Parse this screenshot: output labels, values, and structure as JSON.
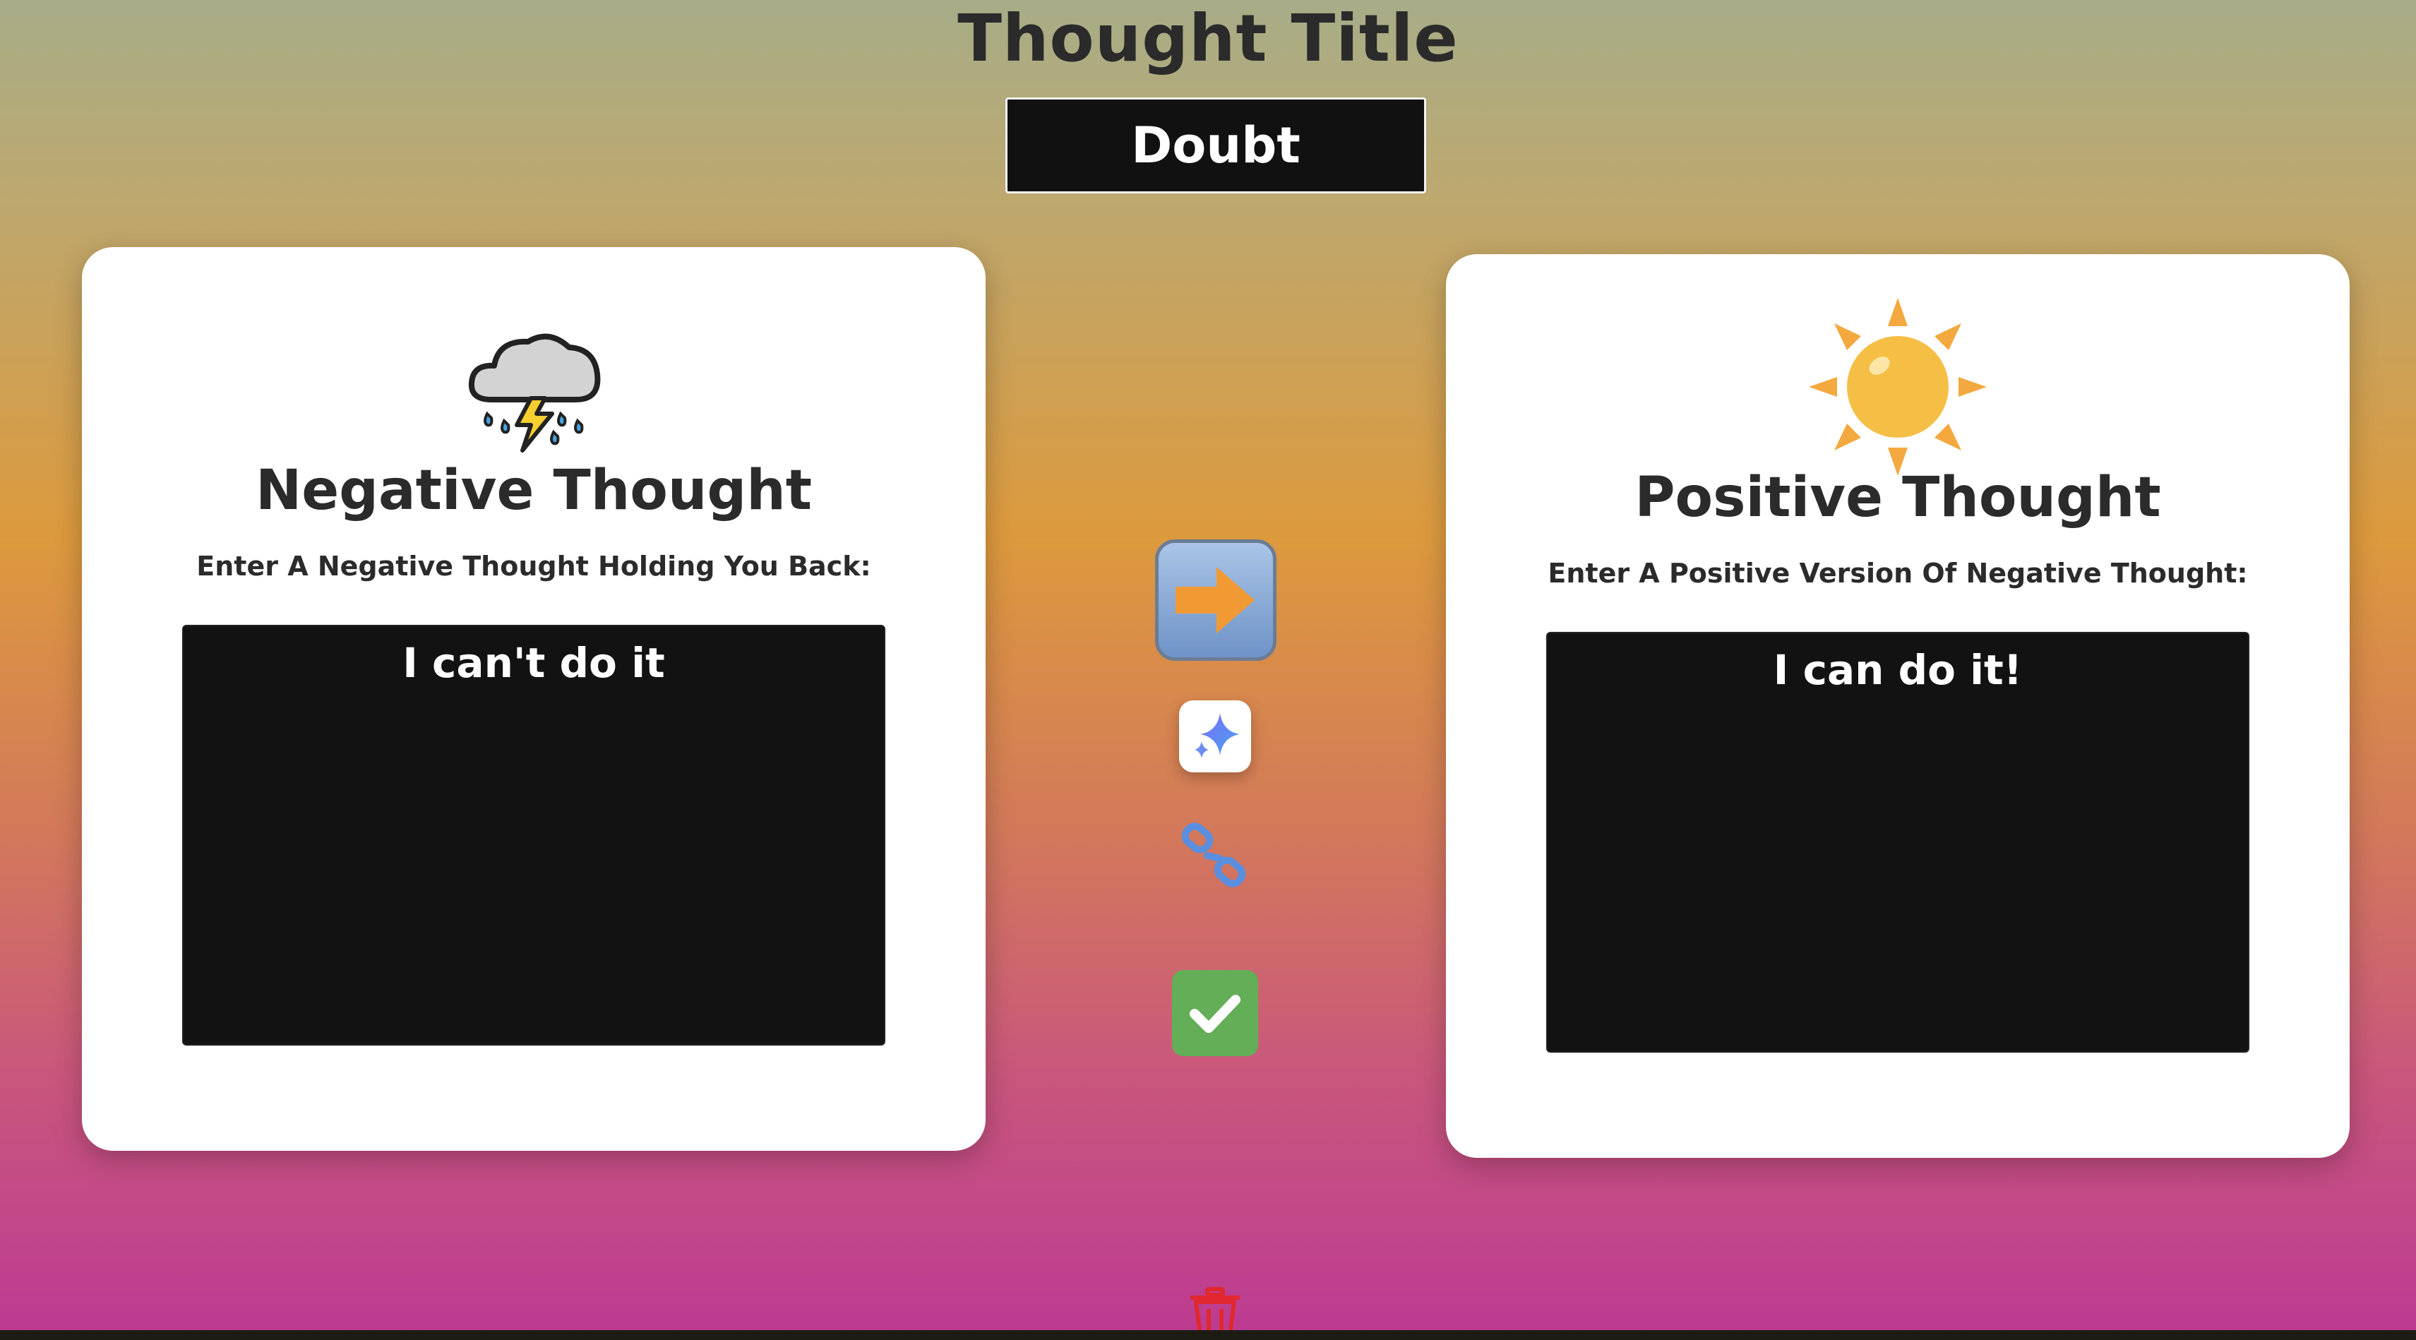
{
  "header": {
    "title": "Thought Title",
    "title_value": "Doubt"
  },
  "negative": {
    "icon": "storm-cloud-icon",
    "heading": "Negative Thought",
    "subheading": "Enter A Negative Thought Holding You Back:",
    "text": "I can't do it"
  },
  "positive": {
    "icon": "sun-icon",
    "heading": "Positive Thought",
    "subheading": "Enter A Positive Version Of Negative Thought:",
    "text": "I can do it!"
  },
  "actions": {
    "convert_icon": "right-arrow-icon",
    "ai_icon": "sparkle-icon",
    "unlink_icon": "broken-link-icon",
    "save_icon": "checkmark-icon",
    "delete_icon": "trash-icon"
  },
  "colors": {
    "card_bg": "#ffffff",
    "textarea_bg": "#121212",
    "check_green": "#63ae57",
    "sun_yellow": "#f5be45",
    "sun_rays": "#f3a93f",
    "delete_red": "#e0282e"
  }
}
